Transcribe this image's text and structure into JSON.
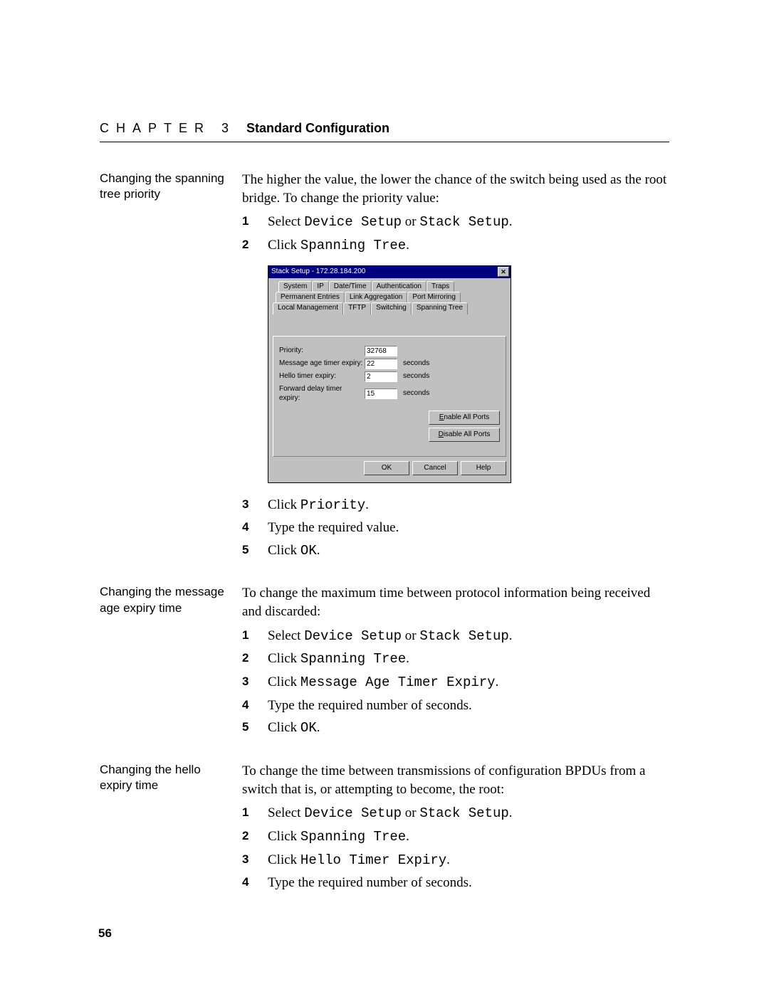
{
  "header": {
    "chapter": "CHAPTER 3",
    "title": "Standard Configuration"
  },
  "section1": {
    "side": "Changing the spanning tree priority",
    "intro": "The higher the value, the lower the chance of the switch being used as the root bridge. To change the priority value:",
    "step1_pre": "Select ",
    "step1_m1": "Device Setup",
    "step1_mid": " or ",
    "step1_m2": "Stack Setup",
    "step1_end": ".",
    "step2_pre": "Click ",
    "step2_m": "Spanning Tree",
    "step2_end": ".",
    "step3_pre": "Click ",
    "step3_m": "Priority",
    "step3_end": ".",
    "step4": "Type the required value.",
    "step5_pre": "Click ",
    "step5_m": "OK",
    "step5_end": "."
  },
  "dialog": {
    "title": "Stack Setup - 172.28.184.200",
    "tabs_row1": [
      "System",
      "IP",
      "Date/Time",
      "Authentication",
      "Traps"
    ],
    "tabs_row2": [
      "Permanent Entries",
      "Link Aggregation",
      "Port Mirroring"
    ],
    "tabs_row3": [
      "Local Management",
      "TFTP",
      "Switching",
      "Spanning Tree"
    ],
    "fields": {
      "priority": {
        "label": "Priority:",
        "value": "32768",
        "suffix": ""
      },
      "msg_age": {
        "label": "Message age timer expiry:",
        "value": "22",
        "suffix": "seconds"
      },
      "hello": {
        "label": "Hello timer expiry:",
        "value": "2",
        "suffix": "seconds"
      },
      "fwd": {
        "label": "Forward delay timer expiry:",
        "value": "15",
        "suffix": "seconds"
      }
    },
    "enable_label_pre": "E",
    "enable_label": "nable All Ports",
    "disable_label_pre": "D",
    "disable_label": "isable All Ports",
    "ok": "OK",
    "cancel": "Cancel",
    "help": "Help"
  },
  "section2": {
    "side": "Changing the message age expiry time",
    "intro": "To change the maximum time between protocol information being received and discarded:",
    "step1_pre": "Select ",
    "step1_m1": "Device Setup",
    "step1_mid": " or ",
    "step1_m2": "Stack Setup",
    "step1_end": ".",
    "step2_pre": "Click ",
    "step2_m": "Spanning Tree",
    "step2_end": ".",
    "step3_pre": "Click ",
    "step3_m": "Message Age Timer Expiry",
    "step3_end": ".",
    "step4": "Type the required number of seconds.",
    "step5_pre": "Click ",
    "step5_m": "OK",
    "step5_end": "."
  },
  "section3": {
    "side": "Changing the hello expiry time",
    "intro": "To change the time between transmissions of configuration BPDUs from a switch that is, or attempting to become, the root:",
    "step1_pre": "Select ",
    "step1_m1": "Device Setup",
    "step1_mid": " or ",
    "step1_m2": "Stack Setup",
    "step1_end": ".",
    "step2_pre": "Click ",
    "step2_m": "Spanning Tree",
    "step2_end": ".",
    "step3_pre": "Click ",
    "step3_m": "Hello Timer Expiry",
    "step3_end": ".",
    "step4": "Type the required number of seconds."
  },
  "page_number": "56"
}
